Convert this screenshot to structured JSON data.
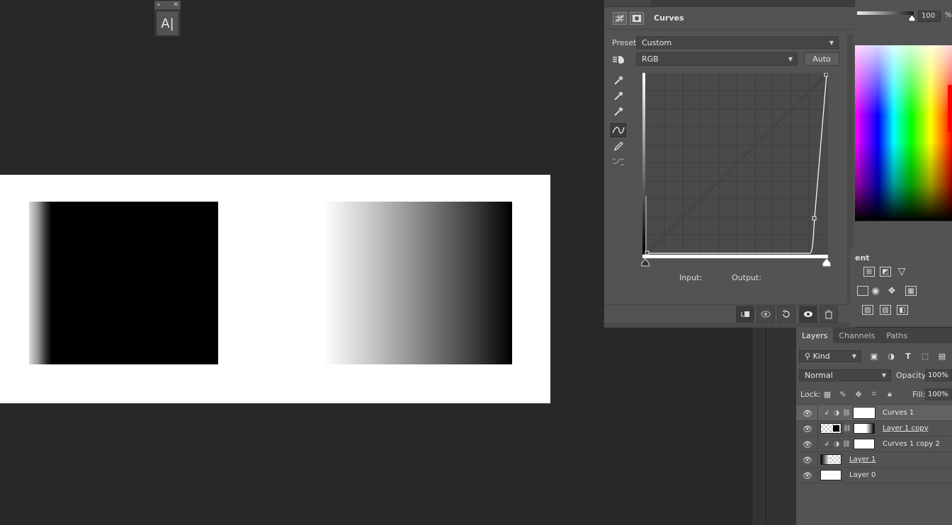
{
  "mini_palette": {
    "tool_glyph": "A|"
  },
  "properties": {
    "title": "Curves",
    "preset_label": "Preset:",
    "preset_value": "Custom",
    "channel_value": "RGB",
    "auto_label": "Auto",
    "input_label": "Input:",
    "output_label": "Output:",
    "curve_points": [
      [
        0,
        0
      ],
      [
        235,
        0
      ],
      [
        240,
        50
      ],
      [
        255,
        255
      ]
    ]
  },
  "color_panel": {
    "value": "100",
    "unit": "%"
  },
  "adjustments": {
    "title": "ent"
  },
  "layers_panel": {
    "tabs": [
      "Layers",
      "Channels",
      "Paths"
    ],
    "filter_kind": "Kind",
    "blend_mode": "Normal",
    "opacity_label": "Opacity:",
    "opacity_value": "100%",
    "lock_label": "Lock:",
    "fill_label": "Fill:",
    "fill_value": "100%",
    "layers": [
      {
        "name": "Curves 1"
      },
      {
        "name": "Layer 1 copy"
      },
      {
        "name": "Curves 1 copy 2"
      },
      {
        "name": "Layer 1"
      },
      {
        "name": "Layer 0"
      }
    ]
  }
}
